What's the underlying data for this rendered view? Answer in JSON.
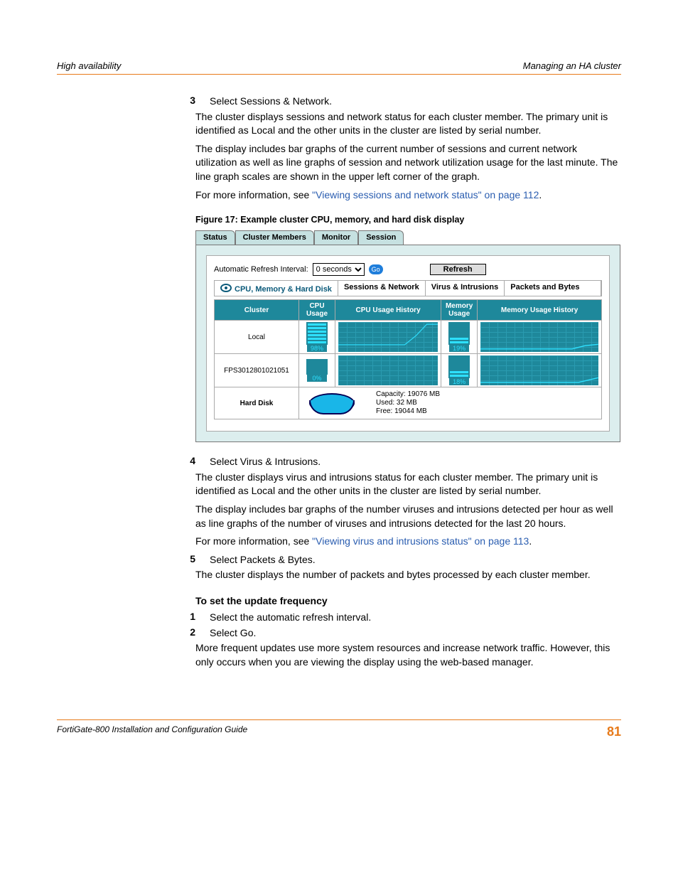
{
  "header": {
    "left": "High availability",
    "right": "Managing an HA cluster"
  },
  "steps1": [
    {
      "num": "3",
      "title": "Select Sessions & Network.",
      "paras": [
        "The cluster displays sessions and network status for each cluster member. The primary unit is identified as Local and the other units in the cluster are listed by serial number.",
        "The display includes bar graphs of the current number of sessions and current network utilization as well as line graphs of session and network utilization usage for the last minute. The line graph scales are shown in the upper left corner of the graph."
      ],
      "more_prefix": "For more information, see ",
      "more_link": "\"Viewing sessions and network status\" on page 112",
      "more_suffix": "."
    }
  ],
  "figcaption": "Figure 17: Example cluster CPU, memory, and hard disk display",
  "fig": {
    "tabs": [
      "Status",
      "Cluster Members",
      "Monitor",
      "Session"
    ],
    "refresh_label": "Automatic Refresh Interval:",
    "refresh_value": "0 seconds",
    "go_label": "Go",
    "refresh_btn": "Refresh",
    "subtabs": [
      "CPU, Memory & Hard Disk",
      "Sessions & Network",
      "Virus & Intrusions",
      "Packets and Bytes"
    ],
    "cols": [
      "Cluster",
      "CPU Usage",
      "CPU Usage History",
      "Memory Usage",
      "Memory Usage History"
    ],
    "rows": [
      {
        "name": "Local",
        "cpu": "98%",
        "mem": "19%"
      },
      {
        "name": "FPS3012801021051",
        "cpu": "0%",
        "mem": "18%"
      }
    ],
    "hd_label": "Hard Disk",
    "hd_info": [
      "Capacity: 19076 MB",
      "Used: 32 MB",
      "Free: 19044 MB"
    ]
  },
  "steps2": [
    {
      "num": "4",
      "title": "Select Virus & Intrusions.",
      "paras": [
        "The cluster displays virus and intrusions status for each cluster member. The primary unit is identified as Local and the other units in the cluster are listed by serial number.",
        "The display includes bar graphs of the number viruses and intrusions detected per hour as well as line graphs of the number of viruses and intrusions detected for the last 20 hours."
      ],
      "more_prefix": "For more information, see ",
      "more_link": "\"Viewing virus and intrusions status\" on page 113",
      "more_suffix": "."
    },
    {
      "num": "5",
      "title": "Select Packets & Bytes.",
      "paras": [
        "The cluster displays the number of packets and bytes processed by each cluster member."
      ]
    }
  ],
  "subhead": "To set the update frequency",
  "steps3": [
    {
      "num": "1",
      "title": "Select the automatic refresh interval.",
      "paras": []
    },
    {
      "num": "2",
      "title": "Select Go.",
      "paras": [
        "More frequent updates use more system resources and increase network traffic. However, this only occurs when you are viewing the display using the web-based manager."
      ]
    }
  ],
  "footer": {
    "left": "FortiGate-800 Installation and Configuration Guide",
    "page": "81"
  },
  "chart_data": {
    "type": "table",
    "title": "Example cluster CPU, memory, and hard disk display",
    "columns": [
      "Cluster",
      "CPU Usage",
      "Memory Usage"
    ],
    "rows": [
      {
        "Cluster": "Local",
        "CPU Usage": 98,
        "Memory Usage": 19
      },
      {
        "Cluster": "FPS3012801021051",
        "CPU Usage": 0,
        "Memory Usage": 18
      }
    ],
    "hard_disk": {
      "capacity_mb": 19076,
      "used_mb": 32,
      "free_mb": 19044
    }
  }
}
